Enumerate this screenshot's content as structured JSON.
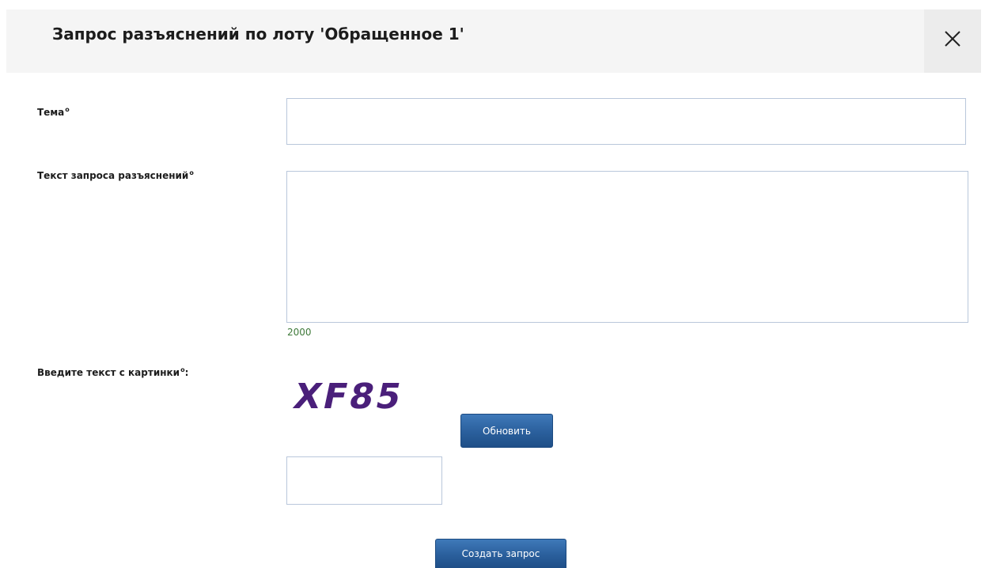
{
  "dialog": {
    "title": "Запрос разъяснений по лоту 'Обращенное 1'",
    "close_icon": "close-icon"
  },
  "form": {
    "subject": {
      "label": "Тема",
      "required_mark": "o",
      "value": ""
    },
    "request_text": {
      "label": "Текст запроса разъяснений",
      "required_mark": "o",
      "value": "",
      "counter": "2000"
    },
    "captcha": {
      "label": "Введите текст с картинки",
      "required_mark": "o",
      "label_suffix": ":",
      "image_text": "XF85",
      "image_color": "#4a1f7a",
      "refresh_label": "Обновить",
      "value": ""
    },
    "submit_label": "Создать запрос"
  },
  "colors": {
    "header_bg": "#f5f5f5",
    "button_blue": "#2a5f9c",
    "field_border": "#b9c7db",
    "counter_green": "#3f7a3a"
  }
}
